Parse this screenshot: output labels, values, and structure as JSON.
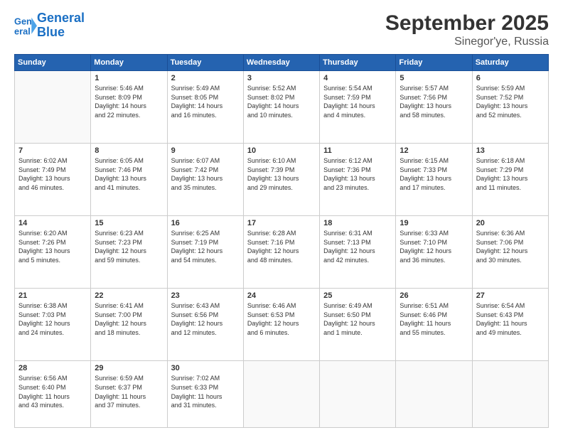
{
  "header": {
    "logo_line1": "General",
    "logo_line2": "Blue",
    "month": "September 2025",
    "location": "Sinegor'ye, Russia"
  },
  "weekdays": [
    "Sunday",
    "Monday",
    "Tuesday",
    "Wednesday",
    "Thursday",
    "Friday",
    "Saturday"
  ],
  "weeks": [
    [
      {
        "day": "",
        "info": ""
      },
      {
        "day": "1",
        "info": "Sunrise: 5:46 AM\nSunset: 8:09 PM\nDaylight: 14 hours\nand 22 minutes."
      },
      {
        "day": "2",
        "info": "Sunrise: 5:49 AM\nSunset: 8:05 PM\nDaylight: 14 hours\nand 16 minutes."
      },
      {
        "day": "3",
        "info": "Sunrise: 5:52 AM\nSunset: 8:02 PM\nDaylight: 14 hours\nand 10 minutes."
      },
      {
        "day": "4",
        "info": "Sunrise: 5:54 AM\nSunset: 7:59 PM\nDaylight: 14 hours\nand 4 minutes."
      },
      {
        "day": "5",
        "info": "Sunrise: 5:57 AM\nSunset: 7:56 PM\nDaylight: 13 hours\nand 58 minutes."
      },
      {
        "day": "6",
        "info": "Sunrise: 5:59 AM\nSunset: 7:52 PM\nDaylight: 13 hours\nand 52 minutes."
      }
    ],
    [
      {
        "day": "7",
        "info": "Sunrise: 6:02 AM\nSunset: 7:49 PM\nDaylight: 13 hours\nand 46 minutes."
      },
      {
        "day": "8",
        "info": "Sunrise: 6:05 AM\nSunset: 7:46 PM\nDaylight: 13 hours\nand 41 minutes."
      },
      {
        "day": "9",
        "info": "Sunrise: 6:07 AM\nSunset: 7:42 PM\nDaylight: 13 hours\nand 35 minutes."
      },
      {
        "day": "10",
        "info": "Sunrise: 6:10 AM\nSunset: 7:39 PM\nDaylight: 13 hours\nand 29 minutes."
      },
      {
        "day": "11",
        "info": "Sunrise: 6:12 AM\nSunset: 7:36 PM\nDaylight: 13 hours\nand 23 minutes."
      },
      {
        "day": "12",
        "info": "Sunrise: 6:15 AM\nSunset: 7:33 PM\nDaylight: 13 hours\nand 17 minutes."
      },
      {
        "day": "13",
        "info": "Sunrise: 6:18 AM\nSunset: 7:29 PM\nDaylight: 13 hours\nand 11 minutes."
      }
    ],
    [
      {
        "day": "14",
        "info": "Sunrise: 6:20 AM\nSunset: 7:26 PM\nDaylight: 13 hours\nand 5 minutes."
      },
      {
        "day": "15",
        "info": "Sunrise: 6:23 AM\nSunset: 7:23 PM\nDaylight: 12 hours\nand 59 minutes."
      },
      {
        "day": "16",
        "info": "Sunrise: 6:25 AM\nSunset: 7:19 PM\nDaylight: 12 hours\nand 54 minutes."
      },
      {
        "day": "17",
        "info": "Sunrise: 6:28 AM\nSunset: 7:16 PM\nDaylight: 12 hours\nand 48 minutes."
      },
      {
        "day": "18",
        "info": "Sunrise: 6:31 AM\nSunset: 7:13 PM\nDaylight: 12 hours\nand 42 minutes."
      },
      {
        "day": "19",
        "info": "Sunrise: 6:33 AM\nSunset: 7:10 PM\nDaylight: 12 hours\nand 36 minutes."
      },
      {
        "day": "20",
        "info": "Sunrise: 6:36 AM\nSunset: 7:06 PM\nDaylight: 12 hours\nand 30 minutes."
      }
    ],
    [
      {
        "day": "21",
        "info": "Sunrise: 6:38 AM\nSunset: 7:03 PM\nDaylight: 12 hours\nand 24 minutes."
      },
      {
        "day": "22",
        "info": "Sunrise: 6:41 AM\nSunset: 7:00 PM\nDaylight: 12 hours\nand 18 minutes."
      },
      {
        "day": "23",
        "info": "Sunrise: 6:43 AM\nSunset: 6:56 PM\nDaylight: 12 hours\nand 12 minutes."
      },
      {
        "day": "24",
        "info": "Sunrise: 6:46 AM\nSunset: 6:53 PM\nDaylight: 12 hours\nand 6 minutes."
      },
      {
        "day": "25",
        "info": "Sunrise: 6:49 AM\nSunset: 6:50 PM\nDaylight: 12 hours\nand 1 minute."
      },
      {
        "day": "26",
        "info": "Sunrise: 6:51 AM\nSunset: 6:46 PM\nDaylight: 11 hours\nand 55 minutes."
      },
      {
        "day": "27",
        "info": "Sunrise: 6:54 AM\nSunset: 6:43 PM\nDaylight: 11 hours\nand 49 minutes."
      }
    ],
    [
      {
        "day": "28",
        "info": "Sunrise: 6:56 AM\nSunset: 6:40 PM\nDaylight: 11 hours\nand 43 minutes."
      },
      {
        "day": "29",
        "info": "Sunrise: 6:59 AM\nSunset: 6:37 PM\nDaylight: 11 hours\nand 37 minutes."
      },
      {
        "day": "30",
        "info": "Sunrise: 7:02 AM\nSunset: 6:33 PM\nDaylight: 11 hours\nand 31 minutes."
      },
      {
        "day": "",
        "info": ""
      },
      {
        "day": "",
        "info": ""
      },
      {
        "day": "",
        "info": ""
      },
      {
        "day": "",
        "info": ""
      }
    ]
  ]
}
